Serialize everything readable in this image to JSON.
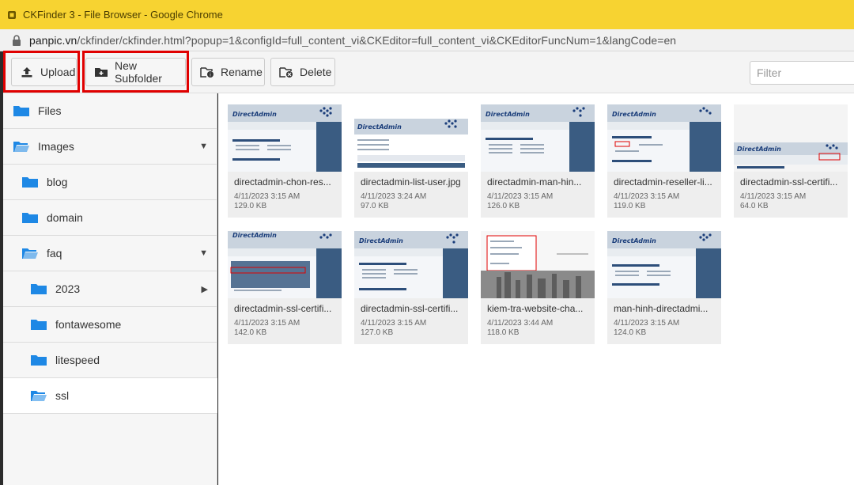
{
  "window": {
    "title": "CKFinder 3 - File Browser - Google Chrome",
    "url_host": "panpic.vn",
    "url_path": "/ckfinder/ckfinder.html?popup=1&configId=full_content_vi&CKEditor=full_content_vi&CKEditorFuncNum=1&langCode=en"
  },
  "toolbar": {
    "upload_label": "Upload",
    "new_subfolder_label": "New Subfolder",
    "rename_label": "Rename",
    "delete_label": "Delete",
    "filter_placeholder": "Filter"
  },
  "sidebar": {
    "items": [
      {
        "label": "Files",
        "icon": "folder-filled-icon",
        "expanded": false
      },
      {
        "label": "Images",
        "icon": "folder-open-icon",
        "expanded": true
      },
      {
        "label": "blog",
        "icon": "folder-filled-icon"
      },
      {
        "label": "domain",
        "icon": "folder-filled-icon"
      },
      {
        "label": "faq",
        "icon": "folder-open-icon",
        "expanded": true
      },
      {
        "label": "2023",
        "icon": "folder-filled-icon",
        "expanded": false
      },
      {
        "label": "fontawesome",
        "icon": "folder-filled-icon"
      },
      {
        "label": "litespeed",
        "icon": "folder-filled-icon"
      },
      {
        "label": "ssl",
        "icon": "folder-open-icon",
        "selected": true
      }
    ]
  },
  "files": [
    {
      "name": "directadmin-chon-res...",
      "date": "4/11/2023 3:15 AM",
      "size": "129.0 KB"
    },
    {
      "name": "directadmin-list-user.jpg",
      "date": "4/11/2023 3:24 AM",
      "size": "97.0 KB"
    },
    {
      "name": "directadmin-man-hin...",
      "date": "4/11/2023 3:15 AM",
      "size": "126.0 KB"
    },
    {
      "name": "directadmin-reseller-li...",
      "date": "4/11/2023 3:15 AM",
      "size": "119.0 KB"
    },
    {
      "name": "directadmin-ssl-certifi...",
      "date": "4/11/2023 3:15 AM",
      "size": "64.0 KB"
    },
    {
      "name": "directadmin-ssl-certifi...",
      "date": "4/11/2023 3:15 AM",
      "size": "142.0 KB"
    },
    {
      "name": "directadmin-ssl-certifi...",
      "date": "4/11/2023 3:15 AM",
      "size": "127.0 KB"
    },
    {
      "name": "kiem-tra-website-cha...",
      "date": "4/11/2023 3:44 AM",
      "size": "118.0 KB"
    },
    {
      "name": "man-hinh-directadmi...",
      "date": "4/11/2023 3:15 AM",
      "size": "124.0 KB"
    }
  ],
  "thumbnail_text": {
    "brand": "DirectAdmin"
  },
  "colors": {
    "title_bar": "#f7d331",
    "folder_blue": "#1e88e5",
    "highlight_red": "#e00000"
  }
}
